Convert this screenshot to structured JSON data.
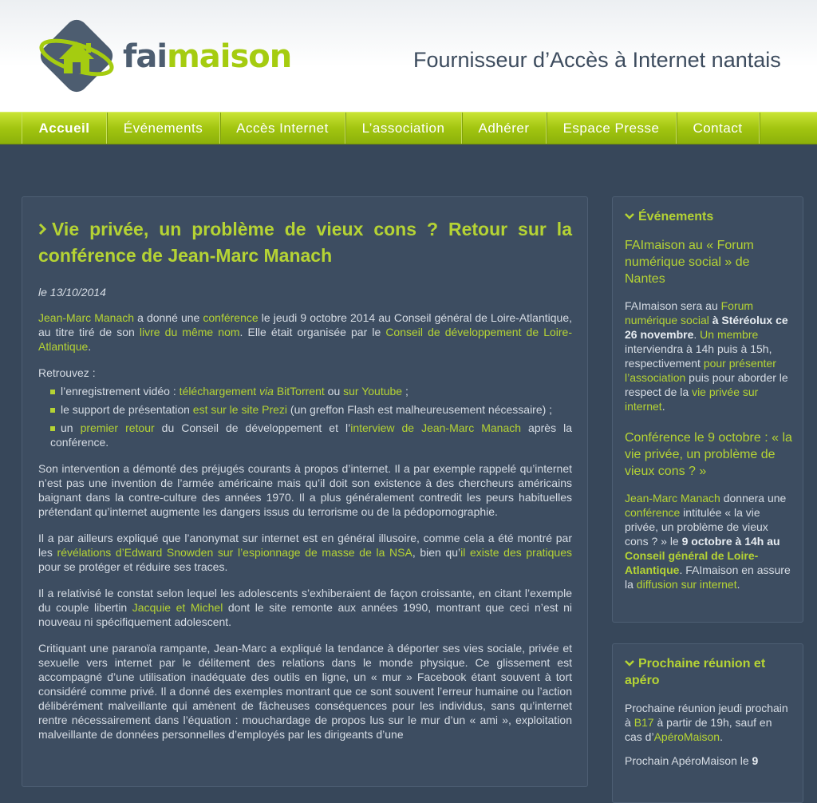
{
  "brand": {
    "fai": "fai",
    "maison": "maison",
    "tagline": "Fournisseur d’Accès à Internet nantais"
  },
  "nav": [
    "Accueil",
    "Événements",
    "Accès Internet",
    "L’association",
    "Adhérer",
    "Espace Presse",
    "Contact"
  ],
  "article": {
    "title": "Vie privée, un problème de vieux cons ? Retour sur la conférence de Jean-Marc Manach",
    "date": "le 13/10/2014",
    "p1": {
      "a1": "Jean-Marc Manach",
      "t1": " a donné une ",
      "a2": "conférence",
      "t2": " le jeudi 9 octobre 2014 au Conseil général de Loire-Atlantique, au titre tiré de son ",
      "a3": "livre du même nom",
      "t3": ". Elle était organisée par le ",
      "a4": "Conseil de développement de Loire-Atlantique",
      "t4": "."
    },
    "retrouvez": "Retrouvez :",
    "li1": {
      "t1": "l’enregistrement vidéo : ",
      "a1": "téléchargement ",
      "a1i": "via",
      "a1b": " BitTorrent",
      "t2": " ou ",
      "a2": "sur Youtube",
      "t3": " ;"
    },
    "li2": {
      "t1": "le support de présentation ",
      "a1": "est sur le site Prezi",
      "t2": " (un greffon Flash est malheureusement nécessaire) ;"
    },
    "li3": {
      "t1": "un ",
      "a1": "premier retour",
      "t2": " du Conseil de développement et l’",
      "a2": "interview de Jean-Marc Manach",
      "t3": " après la conférence."
    },
    "p2": "Son intervention a démonté des préjugés courants à propos d’internet. Il a par exemple rappelé qu’internet n’est pas une invention de l’armée américaine mais qu’il doit son existence à des chercheurs américains baignant dans la contre-culture des années 1970. Il a plus généralement contredit les peurs habituelles prétendant qu’internet augmente les dangers issus du terrorisme ou de la pédopornographie.",
    "p3": {
      "t1": "Il a par ailleurs expliqué que l’anonymat sur internet est en général illusoire, comme cela a été montré par les ",
      "a1": "révélations d’Edward Snowden sur l’espionnage de masse de la NSA",
      "t2": ", bien qu’",
      "a2": "il existe des pratiques",
      "t3": " pour se protéger et réduire ses traces."
    },
    "p4": {
      "t1": "Il a relativisé le constat selon lequel les adolescents s’exhiberaient de façon croissante, en citant l’exemple du couple libertin ",
      "a1": "Jacquie et Michel",
      "t2": " dont le site remonte aux années 1990, montrant que ceci n’est ni nouveau ni spécifiquement adolescent."
    },
    "p5": "Critiquant une paranoïa rampante, Jean-Marc a expliqué la tendance à déporter ses vies sociale, privée et sexuelle vers internet par le délitement des relations dans le monde physique. Ce glissement est accompagné d’une utilisation inadéquate des outils en ligne, un « mur » Facebook étant souvent à tort considéré comme privé. Il a donné des exemples montrant que ce sont souvent l’erreur humaine ou l’action délibérément malveillante qui amènent de fâcheuses conséquences pour les individus, sans qu’internet rentre nécessairement dans l’équation : mouchardage de propos lus sur le mur d’un « ami », exploitation malveillante de données personnelles d’employés par les dirigeants d’une"
  },
  "events": {
    "heading": "Événements",
    "e1_title": "FAImaison au « Forum numérique social » de Nantes",
    "e1": {
      "t1": "FAImaison sera au ",
      "a1": "Forum numérique social",
      "b1": " à Stéréolux ce 26 novembre",
      "t2": ". ",
      "a2": "Un membre",
      "t3": " interviendra à 14h puis à 15h, respectivement ",
      "a3": "pour présenter l’association",
      "t4": " puis pour aborder le respect de la ",
      "a4": "vie privée sur internet",
      "t5": "."
    },
    "e2_title": "Conférence le 9 octobre : « la vie privée, un problème de vieux cons ? »",
    "e2": {
      "a1": "Jean-Marc Manach",
      "t1": " donnera une ",
      "a2": "conférence",
      "t2": " intitulée « la vie privée, un problème de vieux cons ? » le ",
      "b1": "9 octobre à 14h au ",
      "b2": "Conseil général de Loire-Atlantique",
      "t3": ". FAImaison en assure la ",
      "a3": "diffusion sur internet",
      "t4": "."
    }
  },
  "meeting": {
    "heading": "Prochaine réunion et apéro",
    "p1": {
      "t1": "Prochaine réunion jeudi prochain à ",
      "a1": "B17",
      "t2": " à partir de 19h, sauf en cas d’",
      "a2": "ApéroMaison",
      "t3": "."
    },
    "p2": {
      "t1": "Prochain ApéroMaison le ",
      "b1": "9"
    }
  }
}
